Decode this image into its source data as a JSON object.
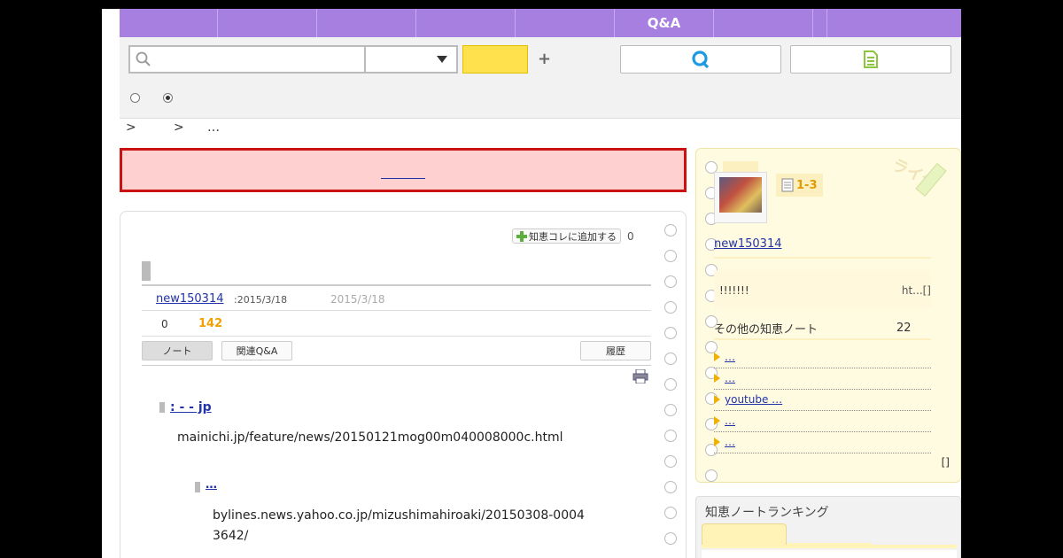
{
  "nav": {
    "items": [
      "",
      "",
      "",
      "",
      "",
      "Q&A",
      "",
      "",
      ""
    ]
  },
  "search": {
    "placeholder": "",
    "category": "",
    "button_label": "",
    "plus": "+"
  },
  "breadcrumb": {
    "sep1": ">",
    "sep2": ">",
    "current": "…"
  },
  "alert": {
    "link_text": ""
  },
  "note": {
    "add_button_label": "知恵コレに追加する",
    "add_count": "0",
    "author": "new150314",
    "post_date": ":2015/3/18",
    "update_date": "2015/3/18",
    "stat_a": "0",
    "stat_b": "142",
    "tabs": {
      "note": "ノート",
      "related": "関連Q&A",
      "history": "履歴"
    },
    "links": [
      {
        "title": ": -  - jp    ",
        "url": "mainichi.jp/feature/news/20150121mog00m040008000c.html"
      },
      {
        "title": "  …            ",
        "url": "bylines.news.yahoo.co.jp/mizushimahiroaki/20150308-00043642/"
      }
    ]
  },
  "sidebar": {
    "note_range": "1-3",
    "watermark": "ライタ",
    "user": "new150314",
    "bio_left": "!!!!!!!",
    "bio_right": "ht...[]",
    "other_label": "その他の知恵ノート",
    "other_count": "22",
    "items": [
      " … ",
      " …    ",
      " youtube …      ",
      " …    ",
      " …   "
    ],
    "footer": "[]"
  },
  "ranking": {
    "title": "知恵ノートランキング"
  },
  "colors": {
    "nav": "#a77fe0",
    "search_button": "#ffe14d",
    "alert_border": "#cc1111",
    "alert_bg": "#ffd0d0",
    "sidebar_bg": "#fffbe0",
    "link": "#2233aa",
    "badge": "#e09a00"
  }
}
